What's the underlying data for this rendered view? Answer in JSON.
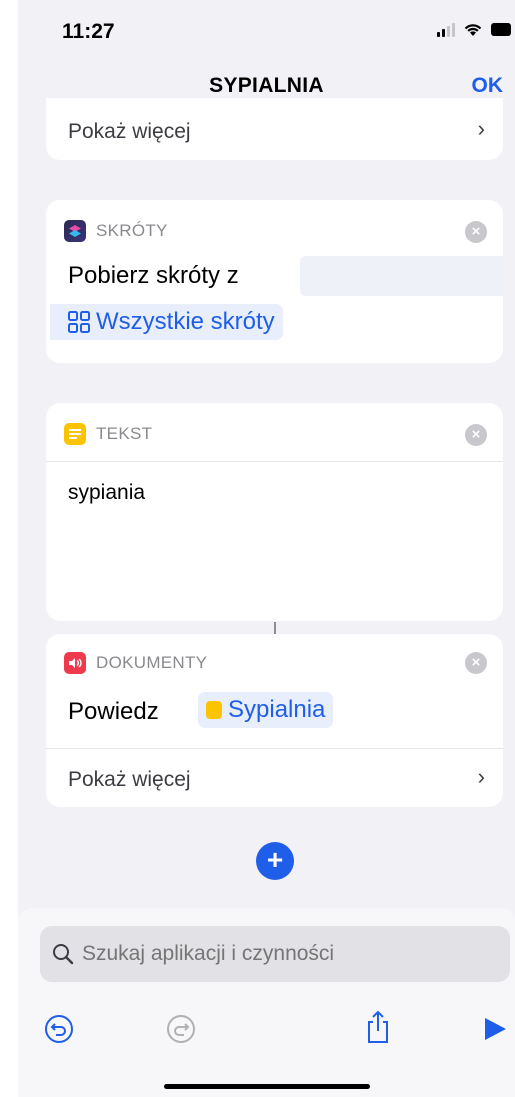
{
  "status_bar": {
    "time": "11:27"
  },
  "nav": {
    "title": "SYPIALNIA",
    "ok_label": "OK"
  },
  "card_top": {
    "show_more": "Pokaż więcej"
  },
  "card_shortcuts": {
    "app_label": "SKRÓTY",
    "action_text": "Pobierz skróty z",
    "parameter": "Wszystkie skróty"
  },
  "card_text": {
    "app_label": "TEKST",
    "content": "sypiania"
  },
  "card_speak": {
    "app_label": "DOKUMENTY",
    "action_text": "Powiedz",
    "variable": "Sypialnia",
    "show_more": "Pokaż więcej"
  },
  "search": {
    "placeholder": "Szukaj aplikacji i czynności"
  },
  "colors": {
    "accent": "#1f5ee8",
    "background": "#f1f1f6",
    "speak_icon": "#ef3a4e",
    "text_icon": "#fcc400"
  }
}
